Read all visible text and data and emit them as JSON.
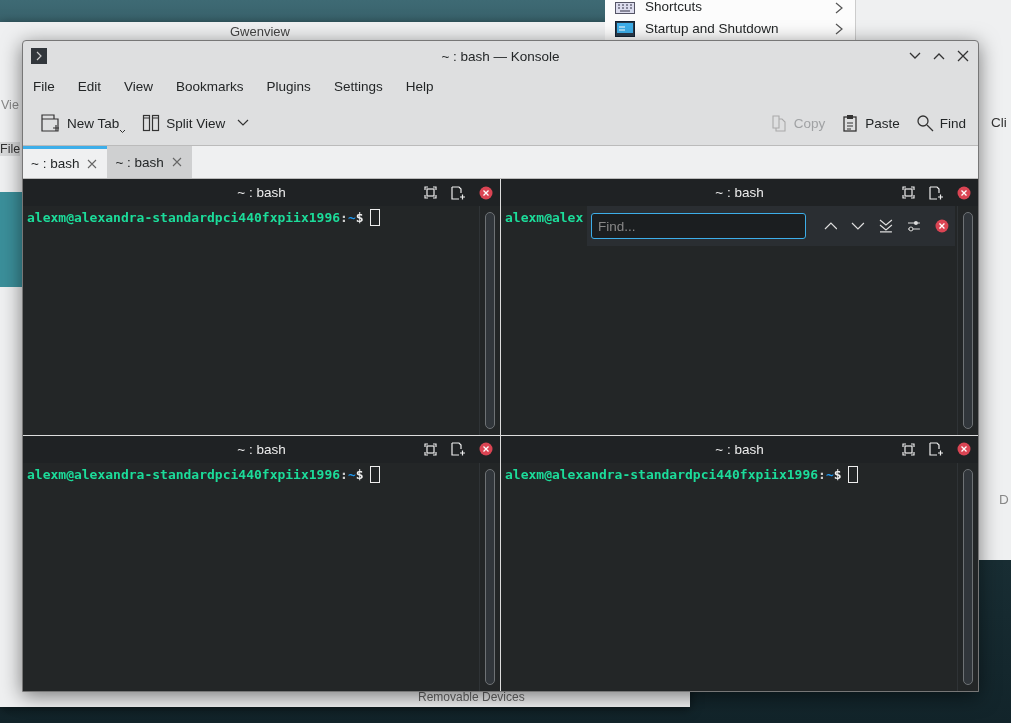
{
  "background": {
    "gwenview_window": {
      "title": "Gwenview",
      "fragments": [
        "Vie",
        "File"
      ],
      "footer": "Removable Devices"
    },
    "settings_window": {
      "items": [
        {
          "label": "Shortcuts",
          "kind": "keyboard"
        },
        {
          "label": "Startup and Shutdown",
          "kind": "monitor"
        }
      ],
      "fragments": [
        "Cli",
        "D"
      ]
    }
  },
  "window": {
    "title": "~ : bash — Konsole"
  },
  "menu": [
    "File",
    "Edit",
    "View",
    "Bookmarks",
    "Plugins",
    "Settings",
    "Help"
  ],
  "toolbar": {
    "left": [
      {
        "label": "New Tab",
        "kind": "new-tab"
      },
      {
        "label": "Split View",
        "kind": "split-view"
      }
    ],
    "right": [
      {
        "label": "Copy",
        "kind": "copy",
        "disabled": true
      },
      {
        "label": "Paste",
        "kind": "paste",
        "disabled": false
      },
      {
        "label": "Find",
        "kind": "find",
        "disabled": false
      }
    ]
  },
  "tabs": [
    {
      "label": "~ : bash",
      "selected": true
    },
    {
      "label": "~ : bash",
      "selected": false
    }
  ],
  "panes": [
    {
      "title": "~ : bash",
      "prompt_user": "alexm@alexandra-standardpci440fxpiix1996",
      "prompt_separator": ":",
      "prompt_path": "~",
      "prompt_symbol": "$"
    },
    {
      "title": "~ : bash",
      "prompt_user": "alexm@alex",
      "find_bar": {
        "placeholder": "Find..."
      }
    },
    {
      "title": "~ : bash",
      "prompt_user": "alexm@alexandra-standardpci440fxpiix1996",
      "prompt_separator": ":",
      "prompt_path": "~",
      "prompt_symbol": "$"
    },
    {
      "title": "~ : bash",
      "prompt_user": "alexm@alexandra-standardpci440fxpiix1996",
      "prompt_separator": ":",
      "prompt_path": "~",
      "prompt_symbol": "$"
    }
  ]
}
